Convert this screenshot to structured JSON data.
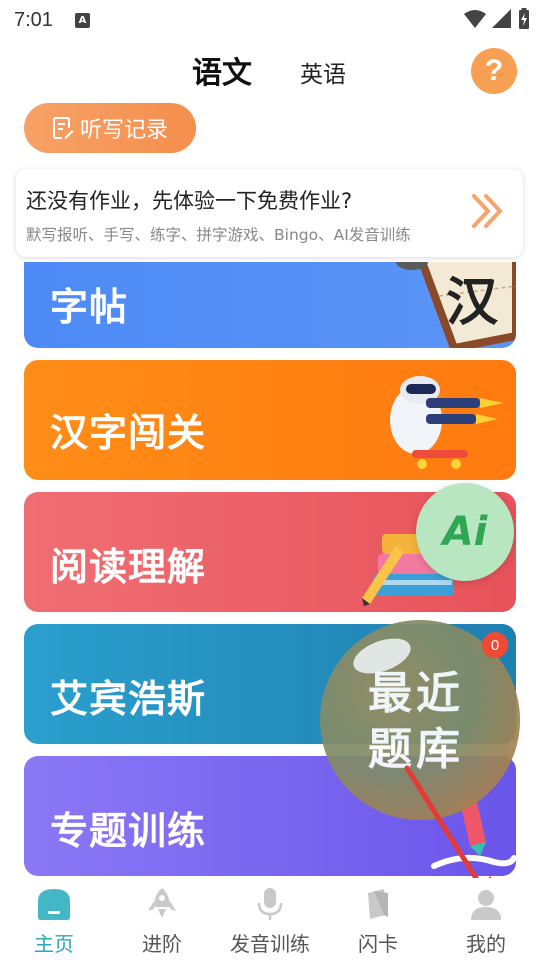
{
  "status_bar": {
    "time": "7:01",
    "notification_letter": "A"
  },
  "header": {
    "tab_chinese": "语文",
    "tab_english": "英语",
    "help_label": "?"
  },
  "dictation_button": {
    "label": "听写记录"
  },
  "promo": {
    "title": "还没有作业，先体验一下免费作业?",
    "subtitle": "默写报听、手写、练字、拼字游戏、Bingo、AI发音训练"
  },
  "cards": {
    "copybook": "字帖",
    "hanzi_challenge": "汉字闯关",
    "reading": "阅读理解",
    "ebbinghaus": "艾宾浩斯",
    "topic_training": "专题训练"
  },
  "copybook_art_char": "汉",
  "ai_button": {
    "label": "Ai"
  },
  "recent_bank": {
    "label": "最近题库",
    "badge_count": "0"
  },
  "tabbar": {
    "items": [
      {
        "label": "主页",
        "icon": "home-icon",
        "active": true
      },
      {
        "label": "进阶",
        "icon": "rocket-icon",
        "active": false
      },
      {
        "label": "发音训练",
        "icon": "microphone-icon",
        "active": false
      },
      {
        "label": "闪卡",
        "icon": "flashcard-icon",
        "active": false
      },
      {
        "label": "我的",
        "icon": "profile-icon",
        "active": false
      }
    ]
  },
  "colors": {
    "accent_orange": "#f7a053",
    "tab_active": "#2aa8b8",
    "card_copybook": "#4d8af5",
    "card_hanzi": "#ff8d17",
    "card_reading": "#ec6068",
    "card_ebbinghaus": "#2592c2",
    "card_topic": "#7a66f0",
    "ai_green": "#b8e6c0"
  }
}
